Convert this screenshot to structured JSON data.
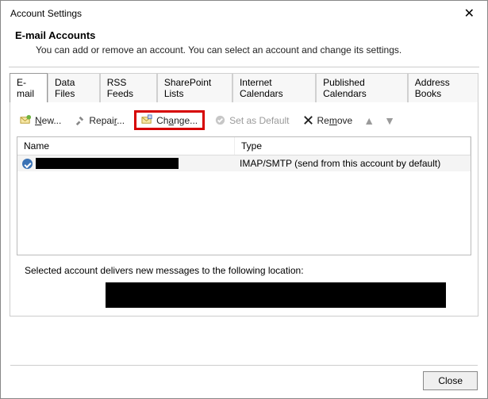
{
  "title": "Account Settings",
  "header": {
    "heading": "E-mail Accounts",
    "desc": "You can add or remove an account. You can select an account and change its settings."
  },
  "tabs": [
    {
      "label": "E-mail",
      "active": true
    },
    {
      "label": "Data Files"
    },
    {
      "label": "RSS Feeds"
    },
    {
      "label": "SharePoint Lists"
    },
    {
      "label": "Internet Calendars"
    },
    {
      "label": "Published Calendars"
    },
    {
      "label": "Address Books"
    }
  ],
  "toolbar": {
    "new": "New...",
    "repair": "Repair...",
    "change": "Change...",
    "set_default": "Set as Default",
    "remove": "Remove"
  },
  "columns": {
    "name": "Name",
    "type": "Type"
  },
  "row": {
    "name": "",
    "type": "IMAP/SMTP (send from this account by default)"
  },
  "footer_text": "Selected account delivers new messages to the following location:",
  "close": "Close"
}
